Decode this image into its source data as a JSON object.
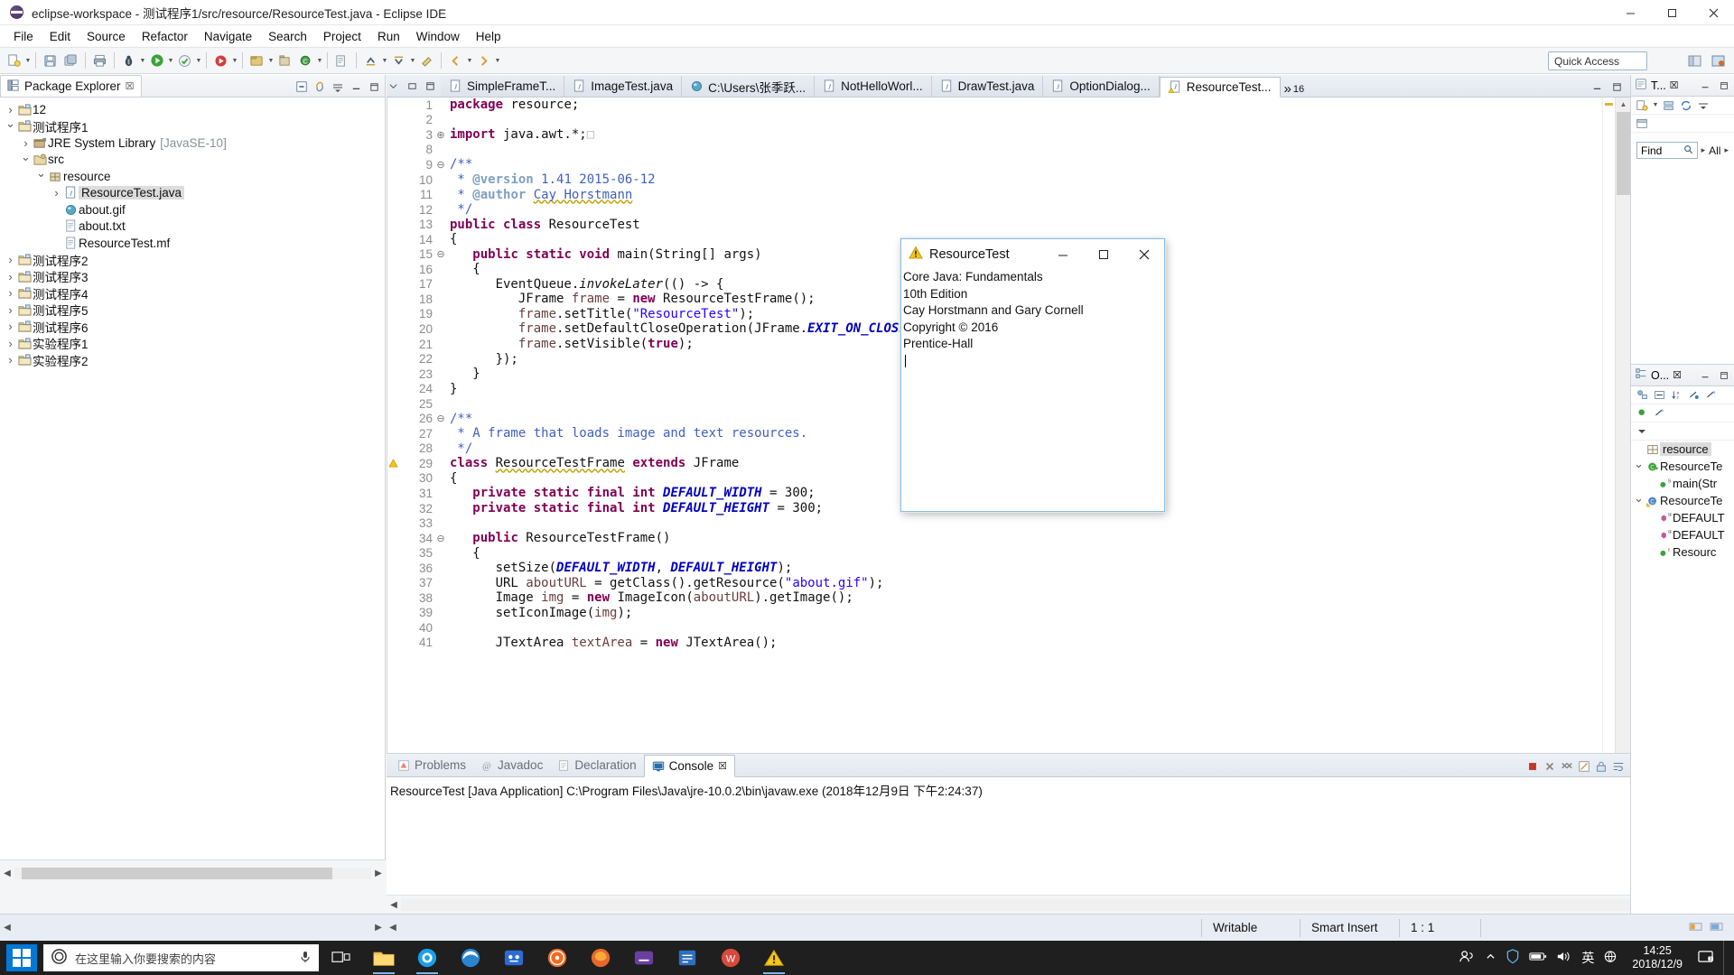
{
  "window": {
    "title": "eclipse-workspace - 测试程序1/src/resource/ResourceTest.java - Eclipse IDE",
    "minimize": "–",
    "maximize": "☐",
    "close": "✕"
  },
  "menubar": [
    "File",
    "Edit",
    "Source",
    "Refactor",
    "Navigate",
    "Search",
    "Project",
    "Run",
    "Window",
    "Help"
  ],
  "toolbar": {
    "quick_access": "Quick Access"
  },
  "package_explorer": {
    "tab_label": "Package Explorer",
    "tab_close": "☒",
    "tree": [
      {
        "label": "12",
        "indent": 0,
        "state": "closed",
        "icon": "project-icon"
      },
      {
        "label": "测试程序1",
        "indent": 0,
        "state": "open",
        "icon": "project-icon"
      },
      {
        "label": "JRE System Library",
        "suffix": "[JavaSE-10]",
        "indent": 1,
        "state": "closed",
        "icon": "library-icon"
      },
      {
        "label": "src",
        "indent": 1,
        "state": "open",
        "icon": "source-folder-icon"
      },
      {
        "label": "resource",
        "indent": 2,
        "state": "open",
        "icon": "package-icon"
      },
      {
        "label": "ResourceTest.java",
        "indent": 3,
        "state": "closed",
        "icon": "java-file-icon",
        "selected": true
      },
      {
        "label": "about.gif",
        "indent": 3,
        "state": "none",
        "icon": "image-file-icon"
      },
      {
        "label": "about.txt",
        "indent": 3,
        "state": "none",
        "icon": "text-file-icon"
      },
      {
        "label": "ResourceTest.mf",
        "indent": 3,
        "state": "none",
        "icon": "text-file-icon"
      },
      {
        "label": "测试程序2",
        "indent": 0,
        "state": "closed",
        "icon": "project-icon"
      },
      {
        "label": "测试程序3",
        "indent": 0,
        "state": "closed",
        "icon": "project-icon"
      },
      {
        "label": "测试程序4",
        "indent": 0,
        "state": "closed",
        "icon": "project-icon"
      },
      {
        "label": "测试程序5",
        "indent": 0,
        "state": "closed",
        "icon": "project-icon"
      },
      {
        "label": "测试程序6",
        "indent": 0,
        "state": "closed",
        "icon": "project-icon"
      },
      {
        "label": "实验程序1",
        "indent": 0,
        "state": "closed",
        "icon": "project-icon"
      },
      {
        "label": "实验程序2",
        "indent": 0,
        "state": "closed",
        "icon": "project-icon"
      }
    ]
  },
  "editor": {
    "tabs": [
      {
        "label": "SimpleFrameT...",
        "icon": "java-file-icon",
        "active": false
      },
      {
        "label": "ImageTest.java",
        "icon": "java-file-icon",
        "active": false
      },
      {
        "label": "C:\\Users\\张季跃...",
        "icon": "image-file-icon",
        "active": false
      },
      {
        "label": "NotHelloWorl...",
        "icon": "java-file-icon",
        "active": false
      },
      {
        "label": "DrawTest.java",
        "icon": "java-file-icon",
        "active": false
      },
      {
        "label": "OptionDialog...",
        "icon": "java-file-icon",
        "active": false
      },
      {
        "label": "ResourceTest...",
        "icon": "java-file-warning-icon",
        "active": true
      }
    ],
    "overflow_label": "»",
    "overflow_count": "16",
    "lines": [
      {
        "n": "1",
        "fold": "",
        "html": "<span class='kw'>package</span> resource;"
      },
      {
        "n": "2",
        "fold": "",
        "html": ""
      },
      {
        "n": "3",
        "fold": "⊕",
        "html": "<span class='kw'>import</span> java.awt.*;<span style='color:#bbb'>□</span>"
      },
      {
        "n": "8",
        "fold": "",
        "html": ""
      },
      {
        "n": "9",
        "fold": "⊖",
        "html": "<span class='jdoc'>/**</span>"
      },
      {
        "n": "10",
        "fold": "",
        "html": "<span class='jdoc'> * </span><span class='jdtag'>@version</span><span class='jdoc'> 1.41 2015-06-12</span>"
      },
      {
        "n": "11",
        "fold": "",
        "html": "<span class='jdoc'> * </span><span class='jdtag'>@author</span><span class='jdoc'> </span><span class='jdoc squiggle'>Cay Horstmann</span>"
      },
      {
        "n": "12",
        "fold": "",
        "html": "<span class='jdoc'> */</span>"
      },
      {
        "n": "13",
        "fold": "",
        "html": "<span class='kw'>public class</span> ResourceTest"
      },
      {
        "n": "14",
        "fold": "",
        "html": "{"
      },
      {
        "n": "15",
        "fold": "⊖",
        "html": "   <span class='kw'>public static void</span> main(String[] args)"
      },
      {
        "n": "16",
        "fold": "",
        "html": "   {"
      },
      {
        "n": "17",
        "fold": "",
        "html": "      EventQueue.<span class='mth'>invokeLater</span>(() -> {"
      },
      {
        "n": "18",
        "fold": "",
        "html": "         JFrame <span class='lvar'>frame</span> = <span class='kw'>new</span> ResourceTestFrame();"
      },
      {
        "n": "19",
        "fold": "",
        "html": "         <span class='lvar'>frame</span>.setTitle(<span class='str'>\"ResourceTest\"</span>);"
      },
      {
        "n": "20",
        "fold": "",
        "html": "         <span class='lvar'>frame</span>.setDefaultCloseOperation(JFrame.<span class='fld'>EXIT_ON_CLOSE</span>);"
      },
      {
        "n": "21",
        "fold": "",
        "html": "         <span class='lvar'>frame</span>.setVisible(<span class='kw'>true</span>);"
      },
      {
        "n": "22",
        "fold": "",
        "html": "      });"
      },
      {
        "n": "23",
        "fold": "",
        "html": "   }"
      },
      {
        "n": "24",
        "fold": "",
        "html": "}"
      },
      {
        "n": "25",
        "fold": "",
        "html": ""
      },
      {
        "n": "26",
        "fold": "⊖",
        "html": "<span class='jdoc'>/**</span>"
      },
      {
        "n": "27",
        "fold": "",
        "html": "<span class='jdoc'> * A frame that loads image and text resources.</span>"
      },
      {
        "n": "28",
        "fold": "",
        "html": "<span class='jdoc'> */</span>"
      },
      {
        "n": "29",
        "fold": "",
        "marker": "warning",
        "html": "<span class='kw'>class</span> <span class='squiggle'>ResourceTestFrame</span> <span class='kw'>extends</span> JFrame"
      },
      {
        "n": "30",
        "fold": "",
        "html": "{"
      },
      {
        "n": "31",
        "fold": "",
        "html": "   <span class='kw'>private static final int</span> <span class='fld'>DEFAULT_WIDTH</span> = 300;"
      },
      {
        "n": "32",
        "fold": "",
        "html": "   <span class='kw'>private static final int</span> <span class='fld'>DEFAULT_HEIGHT</span> = 300;"
      },
      {
        "n": "33",
        "fold": "",
        "html": ""
      },
      {
        "n": "34",
        "fold": "⊖",
        "html": "   <span class='kw'>public</span> ResourceTestFrame()"
      },
      {
        "n": "35",
        "fold": "",
        "html": "   {"
      },
      {
        "n": "36",
        "fold": "",
        "html": "      setSize(<span class='fld'>DEFAULT_WIDTH</span>, <span class='fld'>DEFAULT_HEIGHT</span>);"
      },
      {
        "n": "37",
        "fold": "",
        "html": "      URL <span class='lvar'>aboutURL</span> = getClass().getResource(<span class='str'>\"about.gif\"</span>);"
      },
      {
        "n": "38",
        "fold": "",
        "html": "      Image <span class='lvar'>img</span> = <span class='kw'>new</span> ImageIcon(<span class='lvar'>aboutURL</span>).getImage();"
      },
      {
        "n": "39",
        "fold": "",
        "html": "      setIconImage(<span class='lvar'>img</span>);"
      },
      {
        "n": "40",
        "fold": "",
        "html": ""
      },
      {
        "n": "41",
        "fold": "",
        "html": "      JTextArea <span class='lvar'>textArea</span> = <span class='kw'>new</span> JTextArea();"
      }
    ]
  },
  "right_views": {
    "task_list": {
      "tab_label": "T...",
      "tab_close": "☒",
      "find_label": "Find",
      "all_label": "All"
    },
    "outline": {
      "tab_label": "O...",
      "tab_close": "☒",
      "items": [
        {
          "label": "resource",
          "icon": "package-icon",
          "indent": 0,
          "selected": true,
          "state": "none"
        },
        {
          "label": "ResourceTe",
          "icon": "class-public-icon",
          "indent": 0,
          "state": "open"
        },
        {
          "label": "main(Str",
          "icon": "method-static-icon",
          "indent": 1,
          "state": "none"
        },
        {
          "label": "ResourceTe",
          "icon": "class-default-icon",
          "indent": 0,
          "state": "open"
        },
        {
          "label": "DEFAULT",
          "icon": "field-static-final-icon",
          "indent": 1,
          "state": "none"
        },
        {
          "label": "DEFAULT",
          "icon": "field-static-final-icon",
          "indent": 1,
          "state": "none"
        },
        {
          "label": "Resourc",
          "icon": "constructor-icon",
          "indent": 1,
          "state": "none"
        }
      ]
    }
  },
  "bottom_panel": {
    "tabs": [
      {
        "label": "Problems",
        "icon": "problems-icon",
        "active": false
      },
      {
        "label": "Javadoc",
        "icon": "javadoc-icon",
        "active": false
      },
      {
        "label": "Declaration",
        "icon": "declaration-icon",
        "active": false
      },
      {
        "label": "Console",
        "icon": "console-icon",
        "active": true
      }
    ],
    "tab_close": "☒",
    "console_line": "ResourceTest [Java Application] C:\\Program Files\\Java\\jre-10.0.2\\bin\\javaw.exe (2018年12月9日 下午2:24:37)"
  },
  "statusbar": {
    "writable": "Writable",
    "insert_mode": "Smart Insert",
    "position": "1 : 1"
  },
  "java_dialog": {
    "title": "ResourceTest",
    "minimize": "–",
    "maximize": "☐",
    "close": "✕",
    "lines": [
      "Core Java: Fundamentals",
      "10th Edition",
      "Cay Horstmann and Gary Cornell",
      "Copyright © 2016",
      "Prentice-Hall"
    ]
  },
  "taskbar": {
    "search_placeholder": "在这里输入你要搜索的内容",
    "clock_time": "14:25",
    "clock_date": "2018/12/9",
    "ime_label": "英",
    "apps": [
      {
        "name": "task-view-icon"
      },
      {
        "name": "file-explorer-icon"
      },
      {
        "name": "qq-browser-icon"
      },
      {
        "name": "edge-icon"
      },
      {
        "name": "video-app-icon"
      },
      {
        "name": "music-app-icon"
      },
      {
        "name": "firefox-icon"
      },
      {
        "name": "netease-music-icon"
      },
      {
        "name": "notes-app-icon"
      },
      {
        "name": "wps-icon"
      },
      {
        "name": "eclipse-java-icon"
      }
    ]
  },
  "colors": {
    "accent": "#4a7ab5",
    "keyword": "#7f0055",
    "string": "#2a00ff",
    "comment": "#3f5fbf",
    "field": "#0000c0",
    "warning": "#f5c518"
  }
}
